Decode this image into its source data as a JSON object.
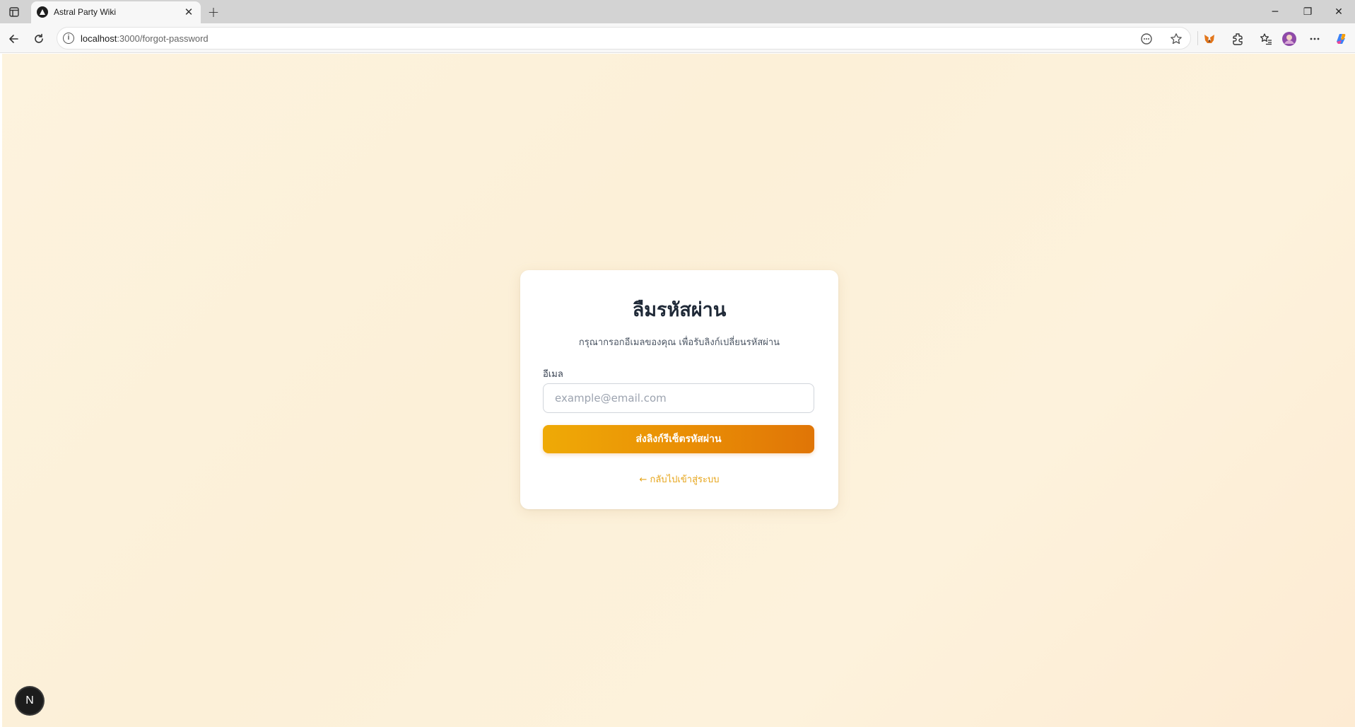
{
  "browser": {
    "tab": {
      "title": "Astral Party Wiki",
      "close_glyph": "✕"
    },
    "new_tab_glyph": "+",
    "window_controls": {
      "minimize": "─",
      "restore": "❐",
      "close": "✕"
    },
    "url": {
      "host": "localhost",
      "path": ":3000/forgot-password"
    },
    "info_glyph": "i"
  },
  "page": {
    "title": "ลืมรหัสผ่าน",
    "subtitle": "กรุณากรอกอีเมลของคุณ เพื่อรับลิงก์เปลี่ยนรหัสผ่าน",
    "email_label": "อีเมล",
    "email_value": "",
    "email_placeholder": "example@email.com",
    "submit_label": "ส่งลิงก์รีเซ็ตรหัสผ่าน",
    "back_link": "← กลับไปเข้าสู่ระบบ",
    "dev_badge": "N"
  },
  "colors": {
    "background": "#fdf3de",
    "card": "#ffffff",
    "button_gradient_start": "#efaa06",
    "button_gradient_end": "#e07506",
    "link": "#e6a418",
    "title": "#1f2937"
  }
}
